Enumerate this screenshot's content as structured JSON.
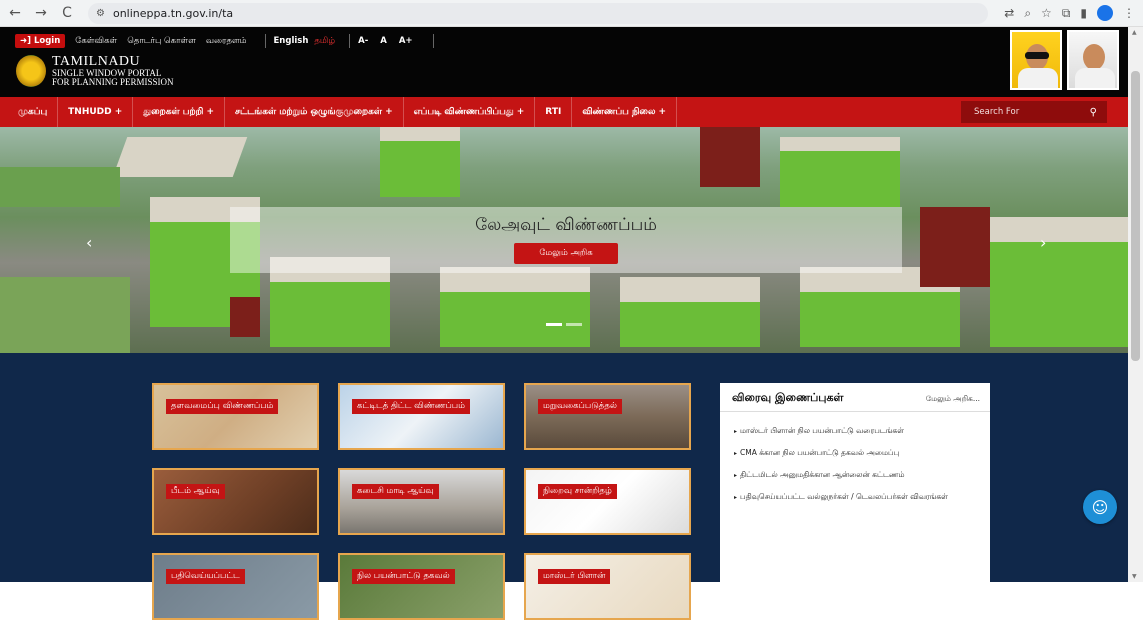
{
  "browser": {
    "url": "onlineppa.tn.gov.in/ta",
    "back_icon": "←",
    "forward_icon": "→",
    "reload_icon": "C",
    "site_info_icon": "⚙"
  },
  "topbar": {
    "login_label": "Login",
    "links": [
      "கேள்விகள்",
      "தொடர்பு கொள்ள",
      "வரைதளம்"
    ],
    "lang_en": "English",
    "lang_ta": "தமிழ்",
    "font_small": "A-",
    "font_normal": "A",
    "font_large": "A+"
  },
  "logo": {
    "line1": "TAMILNADU",
    "line2": "SINGLE WINDOW PORTAL",
    "line3": "FOR PLANNING PERMISSION"
  },
  "nav": {
    "items": [
      "முகப்பு",
      "TNHUDD +",
      "துறைகள் பற்றி +",
      "சட்டங்கள் மற்றும் ஒழுங்குமுறைகள் +",
      "எப்படி விண்ணப்பிப்பது +",
      "RTI",
      "விண்ணப்ப நிலை +"
    ],
    "search_placeholder": "Search For"
  },
  "banner": {
    "title": "லேஅவுட் விண்ணப்பம்",
    "button_label": "மேலும் அறிக"
  },
  "tiles": [
    "தளவமைப்பு விண்ணப்பம்",
    "கட்டிடத் திட்ட விண்ணப்பம்",
    "மறுவகைப்படுத்தல்",
    "பீடம் ஆய்வு",
    "கடைசி மாடி ஆய்வு",
    "நிறைவு சான்றிதழ்",
    "பதிவெய்யப்பட்ட",
    "நில பயன்பாட்டு தகவல்",
    "மாஸ்டர் பிளான்"
  ],
  "quicklinks": {
    "heading": "விரைவு இணைப்புகள்",
    "more_label": "மேலும் அறிக...",
    "items": [
      "மாஸ்டர் பிளான் நில பயன்பாட்டு வரைபடங்கள்",
      "CMA க்கான நில பயன்பாட்டு தகவல் அமைப்பு",
      "திட்டமிடல் அனுமதிக்கான ஆன்லைன் கட்டணம்",
      "பதிவுசெய்யப்பட்ட வல்லுநர்கள் / டெவலப்பர்கள் விவரங்கள்"
    ]
  },
  "colors": {
    "nav_red": "#c41414",
    "header_black": "#050505",
    "lower_navy": "#10284a",
    "tile_border": "#e6a64e"
  }
}
